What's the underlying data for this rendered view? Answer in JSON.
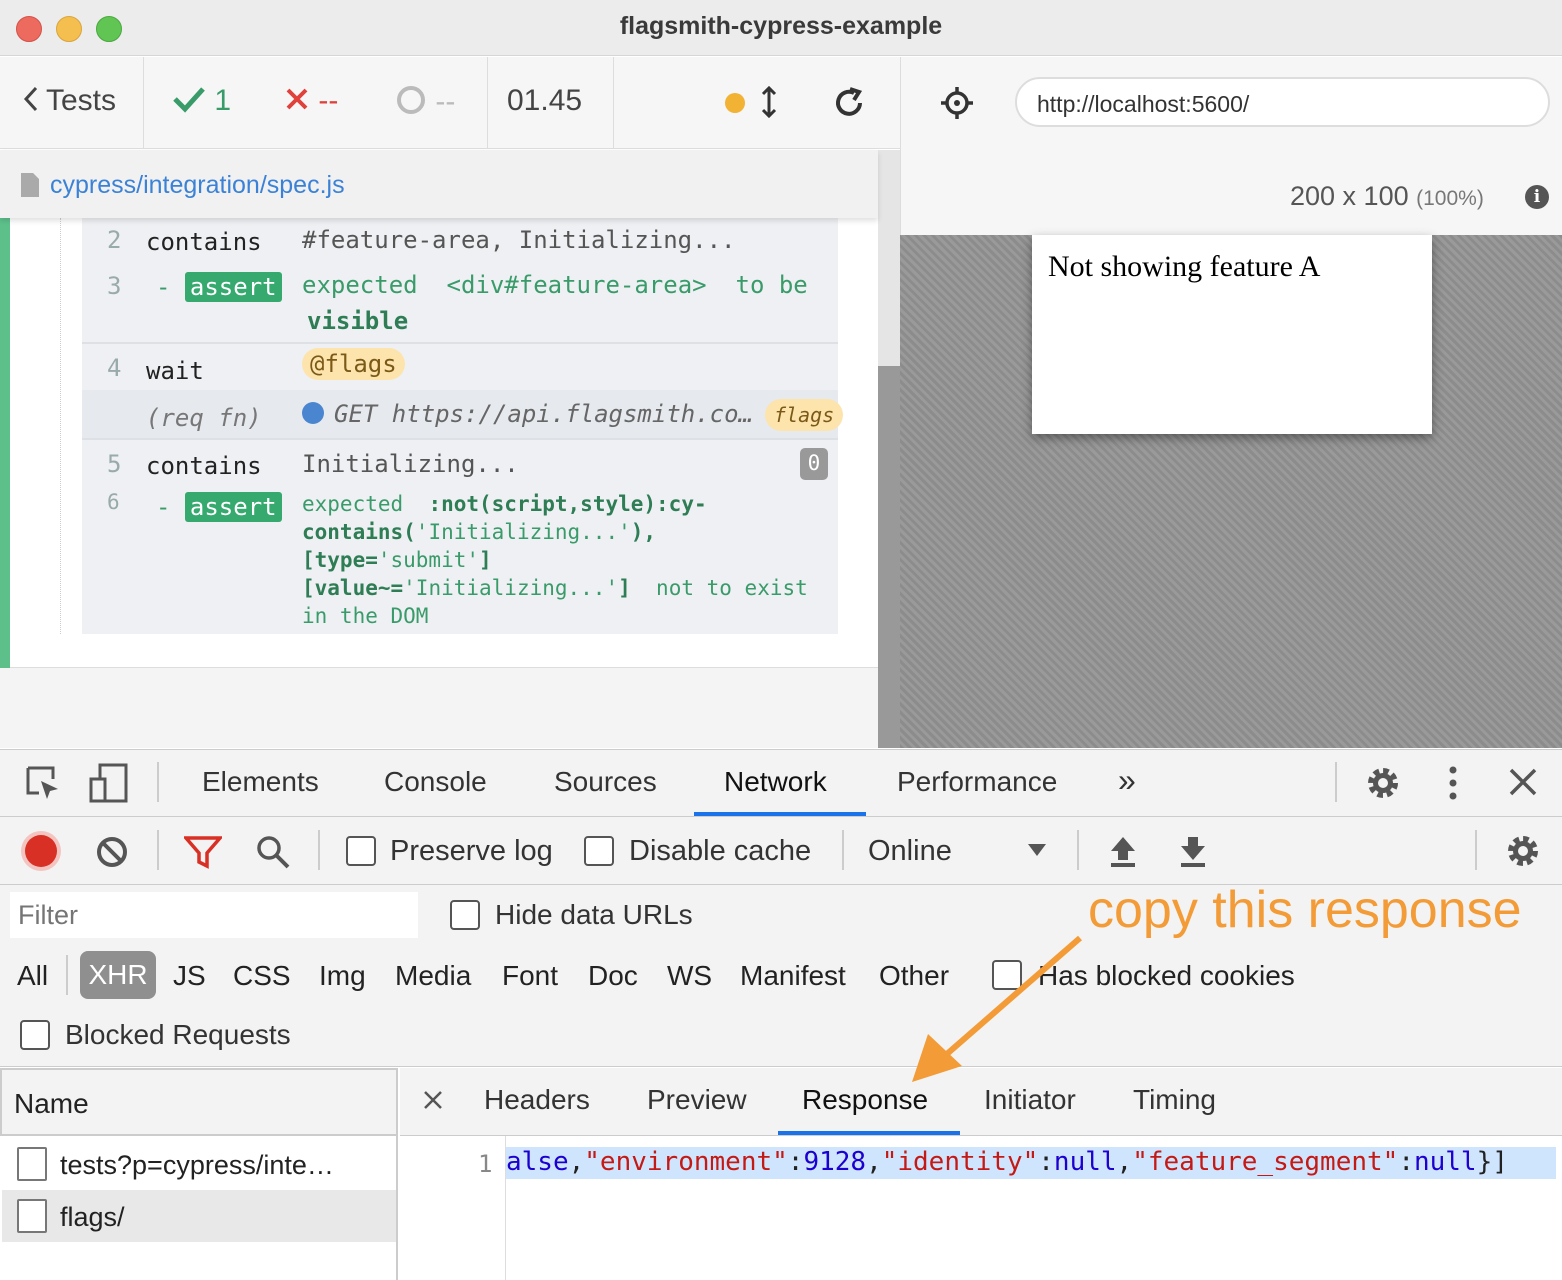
{
  "window": {
    "title": "flagsmith-cypress-example"
  },
  "runner": {
    "back_label": "Tests",
    "passed": "1",
    "failed": "--",
    "pending": "--",
    "duration": "01.45",
    "spec_path": "cypress/integration/spec.js"
  },
  "commands": [
    {
      "num": "2",
      "name": "contains",
      "message": "#feature-area, Initializing..."
    },
    {
      "num": "3",
      "name": "assert",
      "message_1": "expected",
      "message_2": "<div#feature-area>",
      "message_3": "to be",
      "message_4": "visible"
    },
    {
      "num": "4",
      "name": "wait",
      "alias": "@flags"
    },
    {
      "num": "",
      "name": "(req fn)",
      "message": "GET https://api.flagsmith.co…",
      "alias": "flags"
    },
    {
      "num": "5",
      "name": "contains",
      "message": "Initializing...",
      "count": "0"
    },
    {
      "num": "6",
      "name": "assert",
      "line1_a": "expected",
      "line1_b": ":not(script,style):cy-",
      "line2_a": "contains(",
      "line2_b": "'Initializing...'",
      "line2_c": "),",
      "line3_a": "[type=",
      "line3_b": "'submit'",
      "line3_c": "]",
      "line4_a": "[value~=",
      "line4_b": "'Initializing...'",
      "line4_c": "]",
      "line4_d": "not to exist",
      "line5": "in the DOM"
    }
  ],
  "preview": {
    "url": "http://localhost:5600/",
    "viewport_size": "200 x 100",
    "zoom": "(100%)",
    "app_text": "Not showing feature A"
  },
  "devtools": {
    "tabs": [
      "Elements",
      "Console",
      "Sources",
      "Network",
      "Performance"
    ],
    "more": "»",
    "active_tab": "Network",
    "toolbar": {
      "preserve_log": "Preserve log",
      "disable_cache": "Disable cache",
      "throttle": "Online"
    },
    "filter": {
      "placeholder": "Filter",
      "hide_data_urls": "Hide data URLs",
      "types": [
        "All",
        "XHR",
        "JS",
        "CSS",
        "Img",
        "Media",
        "Font",
        "Doc",
        "WS",
        "Manifest",
        "Other"
      ],
      "active_type": "XHR",
      "has_blocked_cookies": "Has blocked cookies",
      "blocked_requests": "Blocked Requests"
    },
    "name_header": "Name",
    "requests": [
      "tests?p=cypress/inte…",
      "flags/"
    ],
    "detail_tabs": [
      "Headers",
      "Preview",
      "Response",
      "Initiator",
      "Timing"
    ],
    "active_detail_tab": "Response",
    "response": {
      "line_number": "1",
      "fragments": [
        {
          "t": "alse",
          "c": "val"
        },
        {
          "t": ",",
          "c": "punct"
        },
        {
          "t": "\"environment\"",
          "c": "key"
        },
        {
          "t": ":",
          "c": "punct"
        },
        {
          "t": "9128",
          "c": "val"
        },
        {
          "t": ",",
          "c": "punct"
        },
        {
          "t": "\"identity\"",
          "c": "key"
        },
        {
          "t": ":",
          "c": "punct"
        },
        {
          "t": "null",
          "c": "val"
        },
        {
          "t": ",",
          "c": "punct"
        },
        {
          "t": "\"feature_segment\"",
          "c": "key"
        },
        {
          "t": ":",
          "c": "punct"
        },
        {
          "t": "null",
          "c": "val"
        },
        {
          "t": "}]",
          "c": "punct"
        }
      ]
    }
  },
  "annotation": {
    "text": "copy this response",
    "color": "#f39b36"
  },
  "colors": {
    "pass_green": "#3a9b6a",
    "fail_red": "#e0413a",
    "link_blue": "#3b82d6",
    "devtools_accent": "#1a73e8"
  }
}
